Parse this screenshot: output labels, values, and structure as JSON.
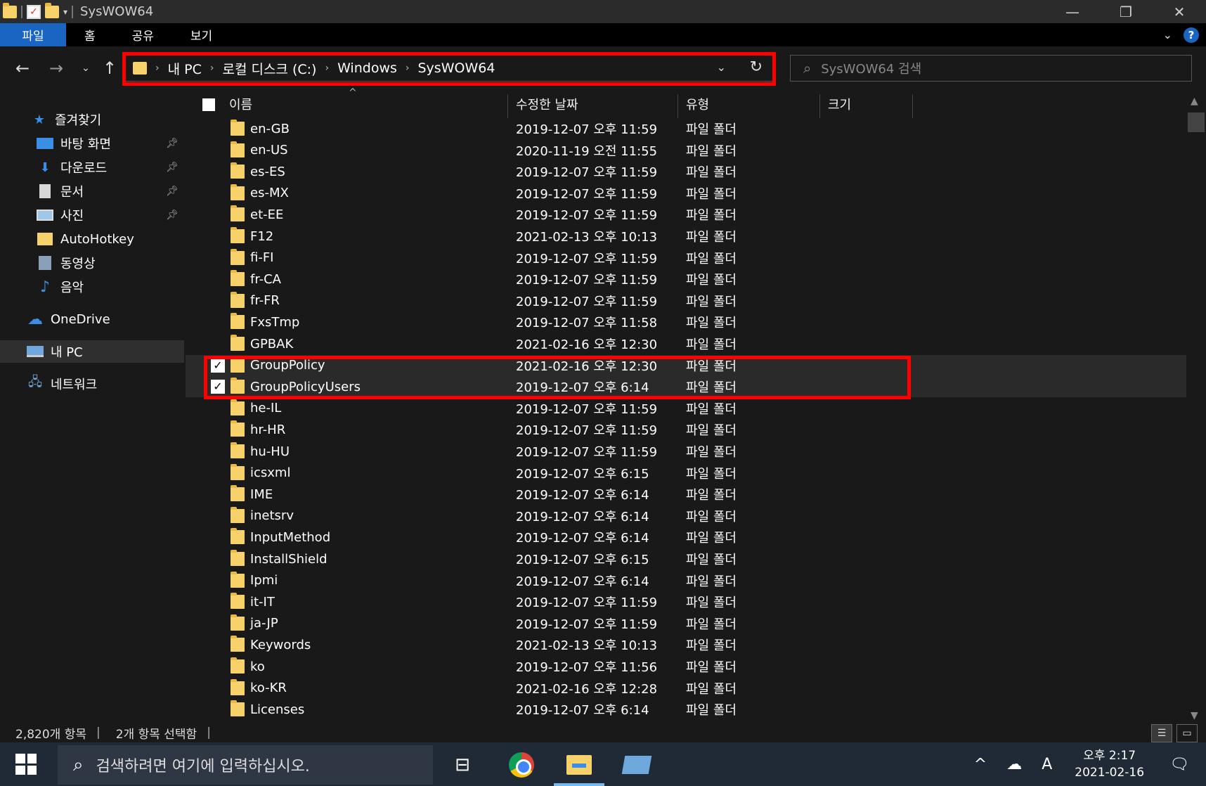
{
  "window": {
    "title": "SysWOW64",
    "controls": {
      "minimize": "—",
      "restore": "❐",
      "close": "✕"
    }
  },
  "ribbon": {
    "tabs": [
      {
        "label": "파일",
        "active": true
      },
      {
        "label": "홈"
      },
      {
        "label": "공유"
      },
      {
        "label": "보기"
      }
    ],
    "help": "?"
  },
  "address": {
    "breadcrumbs": [
      "내 PC",
      "로컬 디스크 (C:)",
      "Windows",
      "SysWOW64"
    ]
  },
  "search": {
    "placeholder": "SysWOW64 검색"
  },
  "sidebar": {
    "items": [
      {
        "label": "즐겨찾기",
        "icon": "star-icon",
        "level": 0
      },
      {
        "label": "바탕 화면",
        "icon": "desktop-icon",
        "level": 1,
        "pinned": true
      },
      {
        "label": "다운로드",
        "icon": "download-icon",
        "level": 1,
        "pinned": true
      },
      {
        "label": "문서",
        "icon": "document-icon",
        "level": 1,
        "pinned": true
      },
      {
        "label": "사진",
        "icon": "picture-icon",
        "level": 1,
        "pinned": true
      },
      {
        "label": "AutoHotkey",
        "icon": "folder-icon",
        "level": 1
      },
      {
        "label": "동영상",
        "icon": "video-icon",
        "level": 1
      },
      {
        "label": "음악",
        "icon": "music-icon",
        "level": 1
      },
      {
        "label": "OneDrive",
        "icon": "cloud-icon",
        "level": 0
      },
      {
        "label": "내 PC",
        "icon": "pc-icon",
        "level": 0,
        "selected": true
      },
      {
        "label": "네트워크",
        "icon": "network-icon",
        "level": 0
      }
    ]
  },
  "columns": {
    "name": "이름",
    "date": "수정한 날짜",
    "type": "유형",
    "size": "크기"
  },
  "files": [
    {
      "name": "en-GB",
      "date": "2019-12-07 오후 11:59",
      "type": "파일 폴더"
    },
    {
      "name": "en-US",
      "date": "2020-11-19 오전 11:55",
      "type": "파일 폴더"
    },
    {
      "name": "es-ES",
      "date": "2019-12-07 오후 11:59",
      "type": "파일 폴더"
    },
    {
      "name": "es-MX",
      "date": "2019-12-07 오후 11:59",
      "type": "파일 폴더"
    },
    {
      "name": "et-EE",
      "date": "2019-12-07 오후 11:59",
      "type": "파일 폴더"
    },
    {
      "name": "F12",
      "date": "2021-02-13 오후 10:13",
      "type": "파일 폴더"
    },
    {
      "name": "fi-FI",
      "date": "2019-12-07 오후 11:59",
      "type": "파일 폴더"
    },
    {
      "name": "fr-CA",
      "date": "2019-12-07 오후 11:59",
      "type": "파일 폴더"
    },
    {
      "name": "fr-FR",
      "date": "2019-12-07 오후 11:59",
      "type": "파일 폴더"
    },
    {
      "name": "FxsTmp",
      "date": "2019-12-07 오후 11:58",
      "type": "파일 폴더"
    },
    {
      "name": "GPBAK",
      "date": "2021-02-16 오후 12:30",
      "type": "파일 폴더"
    },
    {
      "name": "GroupPolicy",
      "date": "2021-02-16 오후 12:30",
      "type": "파일 폴더",
      "selected": true
    },
    {
      "name": "GroupPolicyUsers",
      "date": "2019-12-07 오후 6:14",
      "type": "파일 폴더",
      "selected": true
    },
    {
      "name": "he-IL",
      "date": "2019-12-07 오후 11:59",
      "type": "파일 폴더"
    },
    {
      "name": "hr-HR",
      "date": "2019-12-07 오후 11:59",
      "type": "파일 폴더"
    },
    {
      "name": "hu-HU",
      "date": "2019-12-07 오후 11:59",
      "type": "파일 폴더"
    },
    {
      "name": "icsxml",
      "date": "2019-12-07 오후 6:15",
      "type": "파일 폴더"
    },
    {
      "name": "IME",
      "date": "2019-12-07 오후 6:14",
      "type": "파일 폴더"
    },
    {
      "name": "inetsrv",
      "date": "2019-12-07 오후 6:14",
      "type": "파일 폴더"
    },
    {
      "name": "InputMethod",
      "date": "2019-12-07 오후 6:14",
      "type": "파일 폴더"
    },
    {
      "name": "InstallShield",
      "date": "2019-12-07 오후 6:15",
      "type": "파일 폴더"
    },
    {
      "name": "Ipmi",
      "date": "2019-12-07 오후 6:14",
      "type": "파일 폴더"
    },
    {
      "name": "it-IT",
      "date": "2019-12-07 오후 11:59",
      "type": "파일 폴더"
    },
    {
      "name": "ja-JP",
      "date": "2019-12-07 오후 11:59",
      "type": "파일 폴더"
    },
    {
      "name": "Keywords",
      "date": "2021-02-13 오후 10:13",
      "type": "파일 폴더"
    },
    {
      "name": "ko",
      "date": "2019-12-07 오후 11:56",
      "type": "파일 폴더"
    },
    {
      "name": "ko-KR",
      "date": "2021-02-16 오후 12:28",
      "type": "파일 폴더"
    },
    {
      "name": "Licenses",
      "date": "2019-12-07 오후 6:14",
      "type": "파일 폴더"
    }
  ],
  "status": {
    "count": "2,820개 항목",
    "selected": "2개 항목 선택함"
  },
  "taskbar": {
    "search_placeholder": "검색하려면 여기에 입력하십시오.",
    "ime": "A",
    "time": "오후 2:17",
    "date": "2021-02-16"
  },
  "colors": {
    "accent": "#1a64c2",
    "highlight_box": "#ff0000",
    "folder": "#f7d26b"
  }
}
